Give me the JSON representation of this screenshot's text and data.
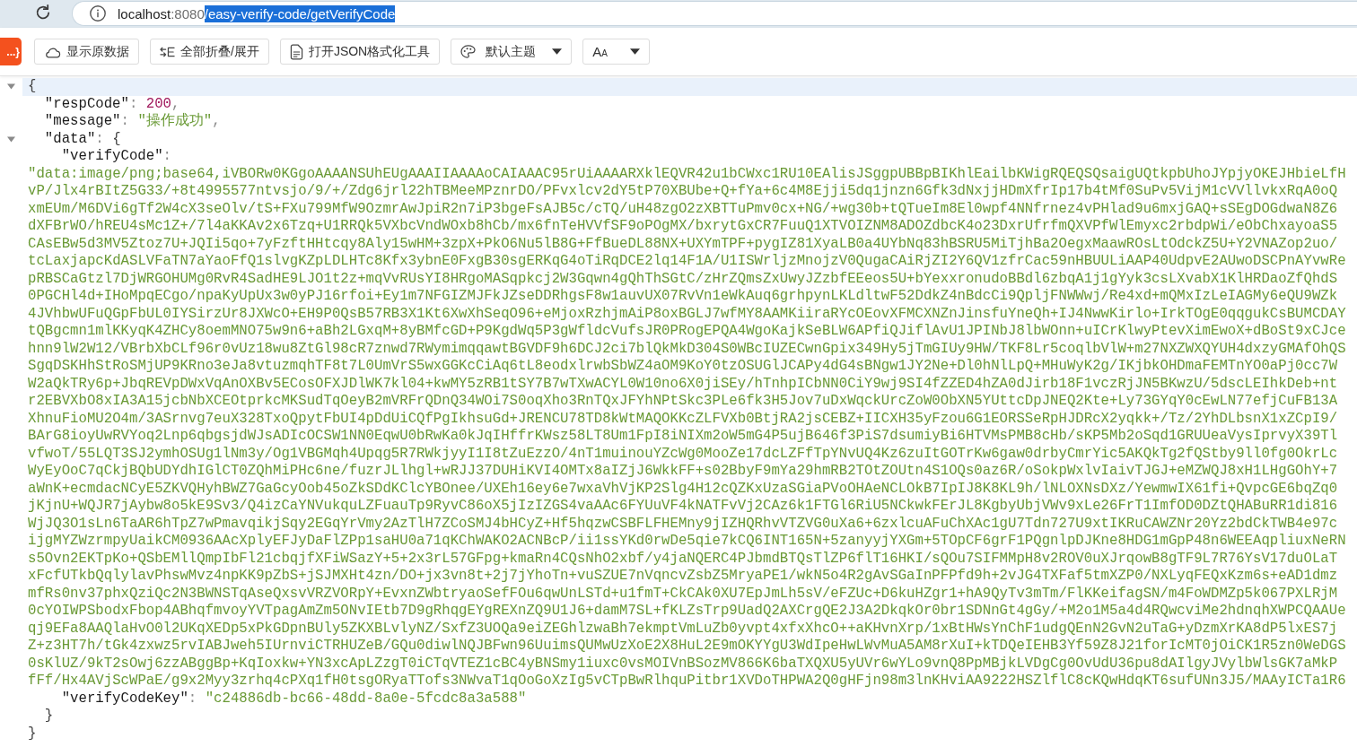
{
  "browser": {
    "url_host": "localhost",
    "url_port": ":8080",
    "url_path": "/easy-verify-code/getVerifyCode",
    "url_path_selected": true
  },
  "extension_logo": "...}",
  "toolbar": [
    {
      "kind": "raw",
      "label": "显示原数据"
    },
    {
      "kind": "fold",
      "label": "全部折叠/展开"
    },
    {
      "kind": "tool",
      "label": "打开JSON格式化工具"
    },
    {
      "kind": "theme",
      "label": "默认主题"
    },
    {
      "kind": "font",
      "label": "A",
      "label_small": "A"
    }
  ],
  "json_tree": {
    "kind": "object",
    "open": "{",
    "close": "}",
    "expanded": true,
    "selected": true,
    "children": [
      {
        "kind": "number",
        "key": "\"respCode\"",
        "sep": ":",
        "value": "200",
        "end": ",",
        "selected": false
      },
      {
        "kind": "string",
        "key": "\"message\"",
        "sep": ":",
        "value": "\"操作成功\"",
        "end": ",",
        "selected": false
      },
      {
        "kind": "object",
        "key": "\"data\"",
        "sep": ":",
        "open": "{",
        "close": "}",
        "expanded": true,
        "selected": false,
        "children": [
          {
            "kind": "wrapped",
            "key": "\"verifyCode\"",
            "sep": ":",
            "selected": false,
            "value_lines": [
              "\"data:image/png;base64,iVBORw0KGgoAAAANSUhEUgAAAIIAAAAoCAIAAAC95rUiAAAARXklEQVR42u1bCWxc1RU10EAlisJSggpUBBpBIKhlEailbKWigRQEQSQsaigUQtkpbUhoJYpjyOKEJHbieLfH",
              "vP/Jlx4rBItZ5G33/+8t4995577ntvsjo/9/+/Zdg6jrl22hTBMeeMPznrDO/PFvxlcv2dY5tP70XBUbe+Q+fYa+6c4M8Ejji5dq1jnzn6Gfk3dNxjjHDmXfrIp17b4tMf0SuPv5VijM1cVVllvkxRqA0oQ",
              "xmEUm/M6DVi6gTf2W4cX3seOlv/tS+FXu799MfW9OzmrAwJpiR2n7iP3bgeFsAJB5c/cTQ/uH48zgO2zXBTTuPmv0cx+NG/+wg30b+tQTueIm8El0wpf4NNfrnez4vPHlad9u6mxjGAQ+sSEgDOGdwaN8Z6",
              "dXFBrWO/hREU4sMc1Z+/7l4aKKAv2x6Tzq+U1RRQk5VXbcVndWOxb8hCb/mx6fnTeHVVfSF9oPOgMX/bxrytGxCR7FuuQ1XTVOIZNM8ADOZdbcK4o23DxrUfrfmQXVPfWlEmyxc2rbdpWi/eObChxayoaS5",
              "CAsEBw5d3MV5Ztoz7U+JQIi5qo+7yFzftHHtcqy8Aly15wHM+3zpX+PkO6Nu5lB8G+FfBueDL88NX+UXYmTPF+pygIZ81XyaLB0a4UYbNq83hBSRU5MiTjhBa2OegxMaawROsLtOdckZ5U+Y2VNAZop2uo/",
              "tcLaxjapcKdASLVFaTN7aYaoFfQ1slvgKZpLDLHTc8Kfx3ybnE0FxgB30sgERKqG4oTiRqDCE2lq14F1A/U1ISWrljzMnojzV0QugaCAiRjZI2Y6QV1zfrCac59nHBUULiAAP40UdpvE2AUwoDSCPnAYvwRe",
              "pRBSCaGtzl7DjWRGOHUMg0RvR4SadHE9LJO1t2z+mqVvRUsYI8HRgoMASqpkcj2W3Gqwn4gQhThSGtC/zHrZQmsZxUwyJZzbfEEeos5U+bYexxronudoBBdl6zbqA1j1gYyk3csLXvabX1KlHRDaoZfQhdS",
              "0PGCHl4d+IHoMpqECgo/npaKyUpUx3w0yPJ16rfoi+Ey1m7NFGIZMJFkJZseDDRhgsF8w1auvUX07RvVn1eWkAuq6grhpynLKLdltwF52DdkZ4nBdcCi9QpljFNWWwj/Re4xd+mQMxIzLeIAGMy6eQU9WZk",
              "4JVhbwUFuQGpFbUL0IYSirzUr8JXWcO+EH9P0QsB57RB3X1Kt6XwXhSeqO96+eMjoxRzhjmAiP8oxBGLJ7wfMY8AAMKiiraRYcOEovXFMCXNZnJinsfuYneQh+IJ4NwwKirlo+IrkTOgE0qqgukCsBUMCDAY",
              "tQBgcmn1mlKKyqK4ZHCy8oemMNO75w9n6+aBh2LGxqM+8yBMfcGD+P9KgdWq5P3gWfldcVufsJR0PRogEPQA4WgoKajkSeBLW6APfiQJiflAvU1JPINbJ8lbWOnn+uICrKlwyPtevXimEwoX+dBoSt9xCJce",
              "hnn9lW2W12/VBrbXbCLf96r0vUz18wu8ZtGl98cR7znwd7RWymimqqawtBGVDF9h6DCJ2ci7blQkMkD304S0WBcIUZECwnGpix349Hy5jTmGIUy9HW/TKF8Lr5coqlbVlW+m27NXZWXQYUH4dxzyGMAfOhQS",
              "SgqDSKHhStRoSMjUP9KRno3eJa8vtuzmqhTF8t7L0UmVrS5wxGGKcCiAq6tL8eodxlrwbSbWZ4aOM9KoY0tzOSUGlJCAPy4dG4sBNgw1JY2Ne+Dl0hNlLpQ+MHuWyK2g/IKjbkOHDmaFEMTnYO0aPj0cc7W",
              "W2aQkTRy6p+JbqREVpDWxVqAnOXBv5ECosOFXJDlWK7kl04+kwMY5zRB1tSY7B7wTXwACYL0W10no6X0jiSEy/hTnhpICbNN0CiY9wj9SI4fZZED4hZA0dJirb18F1vczRjJN5BKwzU/5dscLEIhkDeb+nt",
              "r2EBVXbO8xIA3A15jcbNbXCEOtprkcMKSudTqOeyB2mVRFrQDnQ34WOi7S0oqXho3RnTQxJFYhNPtSkc3PLe6fk3H5Jov7uDxWqckUrcZoW0ObXN5YUttcDpJNEQ2Kte+Ly73GYqY0cEwLN77efjCuFB13A",
              "XhnuFioMU2O4m/3ASrnvg7euX328TxoQpytFbUI4pDdUiCQfPgIkhsuGd+JRENCU78TD8kWtMAQOKKcZLFVXb0BtjRA2jsCEBZ+IICXH35yFzou6G1EORSSeRpHJDRcX2yqkk+/Tz/2YhDLbsnX1xZCpI9/",
              "BArG8ioyUwRVYoq2Lnp6qbgsjdWJsADIcOCSW1NN0EqwU0bRwKa0kJqIHffrKWsz58LT8Um1FpI8iNIXm2oW5mG4P5ujB646f3PiS7dsumiyBi6HTVMsPMB8cHb/sKP5Mb2oSqd1GRUUeaVysIprvyX39Tl",
              "vfwoT/55LQT3SJ2ymhOSUg1lNm3y/Og1VBGMqh4Upqg5R7RWkjyyI1I8tZuEzzO/4nT1muinouYZcWg0MooZe17dcLZFfTpYNvUQ4Kz6zuItGOTrKw6gaw0drbyCmrYic5AKQkTg2fQStby9ll0fg0OkrLc",
              "WyEyOoC7qCkjBQbUDYdhIGlCT0ZQhMiPHc6ne/fuzrJLlhgl+wRJJ37DUHiKVI4OMTx8aIZjJ6WkkFF+s02BbyF9mYa29hmRB2TOtZOUtn4S1OQs0az6R/oSokpWxlvIaivTJGJ+eMZWQJ8xH1LHgGOhY+7",
              "aWnK+ecmdacNCyE5ZKVQHyhBWZ7GaGcyOob45oZkSDdKClcYBOnee/UXEh16ey6e7wxaVhVjKP2Slg4H12cQZKxUzaSGiaPVoOHAeNCLOkB7IpIJ8K8KL9h/lNLOXNsDXz/YewmwIX61fi+QvpcGE6bqZq0",
              "jKjnU+WQJR7jAybw8o5kE9Sv3/Q4izCaYNVukquLZFuauTp9RyvC86oX5jIzIZGS4vaAAc6FYUuVF4kNATFvVj2CAz6k1FTGl6RiU5NCkwkFErJL8KgbyUbjVWv9xLe26FrT1ImfOD0DZtQHABuRR1di816",
              "WjJQ3O1sLn6TaAR6hTpZ7wPmavqikjSqy2EGqYrVmy2AzTlH7ZCoSMJ4bHCyZ+Hf5hqzwCSBFLFHEMny9jIZHQRhvVTZVG0uXa6+6zxlcuAFuChXAc1gU7Tdn727U9xtIKRuCAWZNr20Yz2bdCkTWB4e97c",
              "ijgMYZWzrmpyUaikCM0936AAcXplyEFJyDaFlZPp1saHU0a71qKChWAKO2ACNBcP/ii1ssYKd0rwDe5qie7kCQ6INT165N+5zanyyjYXGm+5TOpCF6grF1PQgnlpDJKne8HDG1mGpP48n6WEEAqpliuxNeRN",
              "s5Ovn2EKTpKo+QSbEMllQmpIbFl21cbqjfXFiWSazY+5+2x3rL57GFpg+kmaRn4CQsNhO2xbf/y4jaNQERC4PJbmdBTQsTlZP6flT16HKI/sQOu7SIFMMpH8v2ROV0uXJrqowB8gTF9L7R76YsV17duOLaT",
              "xFcfUTkbQqlylavPhswMvz4npKK9pZbS+jSJMXHt4zn/DO+jx3vn8t+2j7jYhoTn+vuSZUE7nVqncvZsbZ5MryaPE1/wkN5o4R2gAvSGaInPFPfd9h+2vJG4TXFaf5tmXZP0/NXLyqFEQxKzm6s+eAD1dmz",
              "mfRs0nv37phxQziQc2N3BWNSTqAseQxsvVRZVORpY+EvxnZWbtryaoSefFOu6qwUnLSTd+u1fmT+CkCAk0XU7EpJmLh5sV/eFZUc+D6kuHZgr1+hA9QyTv3mTm/FlKKeifagSN/m4FoWDMZp5k067PXLRjM",
              "0cYOIWPSbodxFbop4ABhqfmvoyYVTpagAmZm5ONvIEtb7D9gRhqgEYgREXnZQ9U1J6+damM7SL+fKLZsTrp9UadQ2AXCrgQE2J3A2DkqkOr0br1SDNnGt4gGy/+M2o1M5a4d4RQwcviMe2hdnqhXWPCQAAUe",
              "qj9EFa8AAQlaHvO0l2UKqXEDp5xPkGDpnBUly5ZKXBLvlyNZ/SxfZ3UOQa9eiZEGhlzwaBh7ekmptVmLuZb0yvpt4xfxXhcO++aKHvnXrp/1xBtHWsYnChF1udgQEnN2GvN2uTaG+yDzmXrKA8dP5lxES7j",
              "Z+z3HT7h/tGk4zxwz5rvIABJweh5IUrnviCTRHUZeB/GQu0diwlNQJBFwn96UuimsQUMwUzXoE2X8HuL2E9mOKYYgU3WdIpeHwLWvMuA5AM8rXuI+kTDQeIEHB3Yf59Z8J21forIcMT0jOiCK1R5zn0WeDGS",
              "0sKlUZ/9kT2sOwj6zzABggBp+KqIoxkw+YN3xcApLZzgT0iCTqVTEZ1cBC4yBNSmy1iuxc0vsMOIVnBSozMV866K6baTXQXU5yUVr6wYLo9vnQ8PpMBjkLVDgCg0OvUdU36pu8dAIlgyJVylbWlsGK7aMkP",
              "fFf/Hx4AVjScWPaE/g9x2Myy3zrhq4cPXq1fH0tsgORyaTTofs3NWvaT1qOoGoXzIg5vCTpBwRlhquPitbr1XVDoTHPWA2Q0gHFjn98m3lnKHviAA9222HSZlflC8cKQwHdqKT6sufUNn3J5/MAAyICTa1R6"
            ]
          },
          {
            "kind": "string",
            "key": "\"verifyCodeKey\"",
            "sep": ":",
            "value": "\"c24886db-bc66-48dd-8a0e-5fcdc8a3a588\"",
            "selected": false
          }
        ]
      }
    ]
  }
}
